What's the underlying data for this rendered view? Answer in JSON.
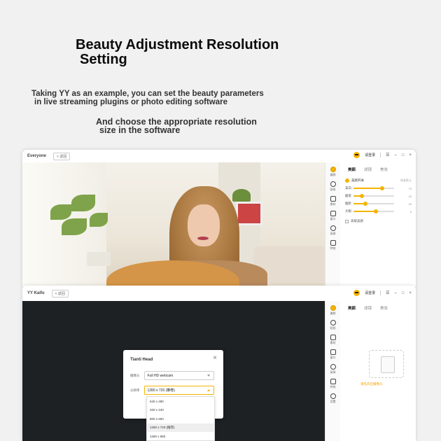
{
  "intro": {
    "title_line1": "Beauty Adjustment Resolution",
    "title_line2": "Setting",
    "desc1_line1": "Taking YY as an example, you can set the beauty parameters",
    "desc1_line2": "in live streaming plugins or photo editing software",
    "desc2_line1": "And choose the appropriate resolution",
    "desc2_line2": "size in the software"
  },
  "window1": {
    "app_name": "Everyone",
    "back_label": "< 返回",
    "login_label": "请登录",
    "controls": {
      "menu": "☰",
      "minimize": "–",
      "restore": "□",
      "close": "×"
    },
    "rail": [
      {
        "label": "美颜",
        "icon": "beauty-icon",
        "active": true
      },
      {
        "label": "贴纸",
        "icon": "sticker-icon"
      },
      {
        "label": "素材",
        "icon": "media-icon"
      },
      {
        "label": "窗口",
        "icon": "window-icon"
      },
      {
        "label": "录屏",
        "icon": "record-icon"
      },
      {
        "label": "特效",
        "icon": "effects-icon"
      }
    ],
    "panel": {
      "tabs": [
        "美颜",
        "滤镜",
        "美妆"
      ],
      "toggle_label": "美颜开关",
      "toggle_state": "恢复默认",
      "sliders": [
        {
          "label": "美白",
          "value": "70",
          "level": 0.7
        },
        {
          "label": "磨皮",
          "value": "20",
          "level": 0.2
        },
        {
          "label": "瘦脸",
          "value": "30",
          "level": 0.3
        },
        {
          "label": "大眼",
          "value": "8",
          "level": 0.55
        }
      ],
      "checkbox_label": "高级美颜"
    }
  },
  "window2": {
    "app_name": "YY Kaifu",
    "back_label": "< 返回",
    "login_label": "请登录",
    "controls": {
      "menu": "☰",
      "minimize": "–",
      "restore": "□",
      "close": "×"
    },
    "rail": [
      {
        "label": "美颜",
        "icon": "beauty-icon",
        "active": true
      },
      {
        "label": "贴纸",
        "icon": "sticker-icon"
      },
      {
        "label": "素材",
        "icon": "media-icon"
      },
      {
        "label": "窗口",
        "icon": "window-icon"
      },
      {
        "label": "录屏",
        "icon": "record-icon"
      },
      {
        "label": "特效",
        "icon": "effects-icon"
      },
      {
        "label": "设置",
        "icon": "settings-icon"
      }
    ],
    "panel": {
      "tabs": [
        "美颜",
        "滤镜",
        "美妆"
      ],
      "hint_prefix": "未检测到摄像头,",
      "hint_link": "请先开启摄像头"
    }
  },
  "dialog": {
    "title": "Tianti Head",
    "close": "×",
    "camera_label": "摄像头",
    "camera_value": "Full HD webcam",
    "resolution_label": "分辨率",
    "resolution_value": "1280 x 720 (推荐)",
    "options": [
      "640 x 480",
      "320 x 240",
      "800 x 600",
      "1280 x 720 (推荐)",
      "1280 x 960"
    ],
    "selected_option": 3
  }
}
